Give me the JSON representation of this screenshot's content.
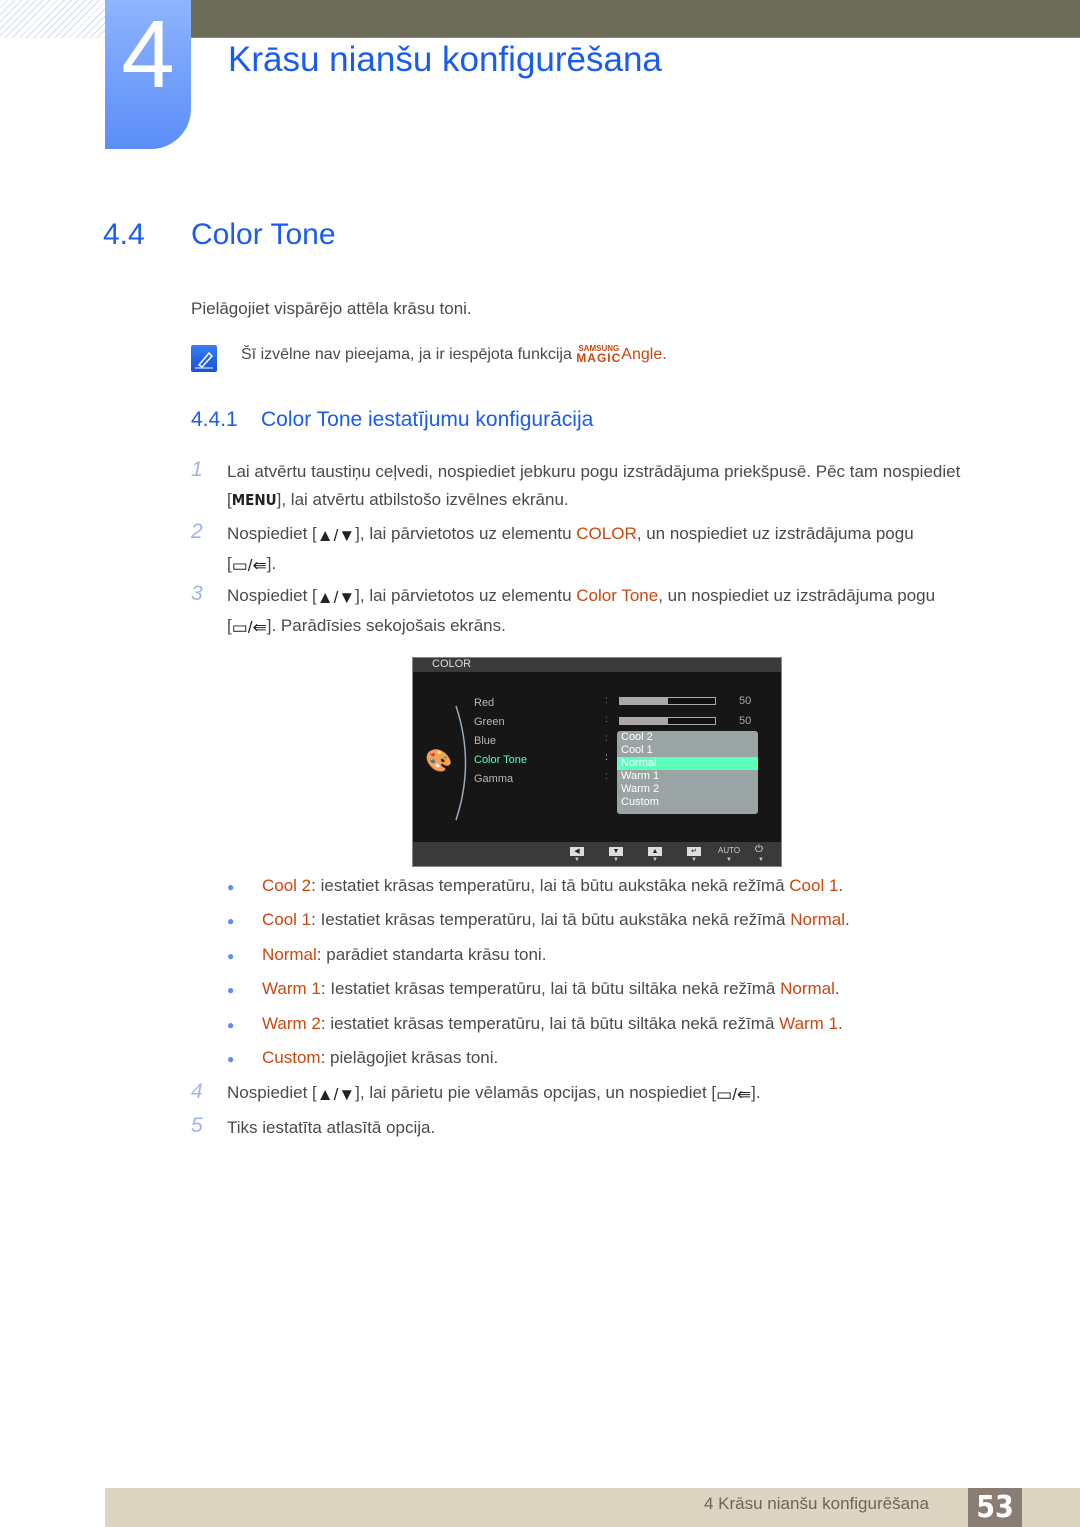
{
  "chapter": {
    "number": "4",
    "title": "Krāsu nianšu konfigurēšana"
  },
  "section": {
    "number": "4.4",
    "title": "Color Tone"
  },
  "intro": "Pielāgojiet vispārējo attēla krāsu toni.",
  "note": {
    "text": "Šī izvēlne nav pieejama, ja ir iespējota funkcija ",
    "brand_small": "SAMSUNG",
    "brand_magic": "MAGIC",
    "brand_angle": "Angle",
    "end": "."
  },
  "subsection": {
    "number": "4.4.1",
    "title": "Color Tone iestatījumu konfigurācija"
  },
  "steps": [
    {
      "n": "1",
      "a": "Lai atvērtu taustiņu ceļvedi, nospiediet jebkuru pogu izstrādājuma priekšpusē. Pēc tam nospiediet",
      "b1": "[",
      "key": "MENU",
      "b2": "], lai atvērtu atbilstošo izvēlnes ekrānu."
    },
    {
      "n": "2",
      "a": "Nospiediet [",
      "b": "], lai pārvietotos uz elementu ",
      "hl": "COLOR",
      "c": ", un nospiediet uz izstrādājuma pogu",
      "d1": "[",
      "d2": "]."
    },
    {
      "n": "3",
      "a": "Nospiediet [",
      "b": "], lai pārvietotos uz elementu ",
      "hl": "Color Tone",
      "c": ", un nospiediet uz izstrādājuma pogu",
      "d1": "[",
      "d2": "]. Parādīsies sekojošais ekrāns."
    },
    {
      "n": "4",
      "a": "Nospiediet [",
      "b": "], lai pārietu pie vēlamās opcijas, un nospiediet [",
      "c": "]."
    },
    {
      "n": "5",
      "a": "Tiks iestatīta atlasītā opcija."
    }
  ],
  "osd": {
    "title": "COLOR",
    "items": [
      "Red",
      "Green",
      "Blue",
      "Color Tone",
      "Gamma"
    ],
    "red_value": "50",
    "green_value": "50",
    "red_level": 50,
    "green_level": 50,
    "options": [
      "Cool 2",
      "Cool 1",
      "Normal",
      "Warm 1",
      "Warm 2",
      "Custom"
    ],
    "selected": "Normal",
    "auto": "AUTO",
    "highlight_color": "#5cffbc"
  },
  "bullets": [
    {
      "term": "Cool 2",
      "text": ": iestatiet krāsas temperatūru, lai tā būtu aukstāka nekā režīmā ",
      "ref": "Cool 1",
      "end": "."
    },
    {
      "term": "Cool 1",
      "text": ": Iestatiet krāsas temperatūru, lai tā būtu aukstāka nekā režīmā ",
      "ref": "Normal",
      "end": "."
    },
    {
      "term": "Normal",
      "text": ": parādiet standarta krāsu toni.",
      "ref": "",
      "end": ""
    },
    {
      "term": "Warm 1",
      "text": ": Iestatiet krāsas temperatūru, lai tā būtu siltāka nekā režīmā ",
      "ref": "Normal",
      "end": "."
    },
    {
      "term": "Warm 2",
      "text": ": iestatiet krāsas temperatūru, lai tā būtu siltāka nekā režīmā ",
      "ref": "Warm 1",
      "end": "."
    },
    {
      "term": "Custom",
      "text": ": pielāgojiet krāsas toni.",
      "ref": "",
      "end": ""
    }
  ],
  "footer": {
    "text": "4 Krāsu nianšu konfigurēšana",
    "page": "53"
  },
  "colors": {
    "accent_blue": "#1a5cf0",
    "highlight_orange": "#c9480f"
  }
}
